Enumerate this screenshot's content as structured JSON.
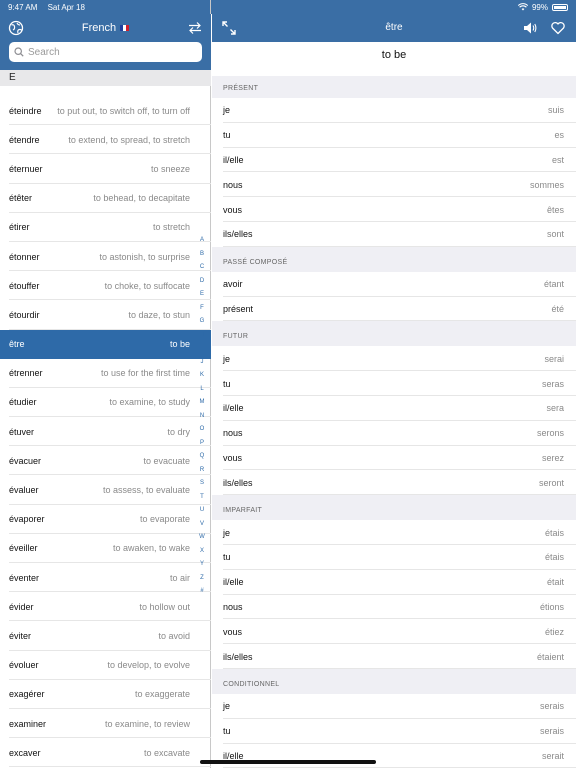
{
  "status_bar": {
    "time": "9:47 AM",
    "date": "Sat Apr 18",
    "battery": "99%"
  },
  "left_header": {
    "language": "French",
    "search_placeholder": "Search"
  },
  "section_letter": "E",
  "words": [
    {
      "fr": "éteindre",
      "en": "to put out, to switch off, to turn off"
    },
    {
      "fr": "étendre",
      "en": "to extend, to spread, to stretch"
    },
    {
      "fr": "éternuer",
      "en": "to sneeze"
    },
    {
      "fr": "étêter",
      "en": "to behead, to decapitate"
    },
    {
      "fr": "étirer",
      "en": "to stretch"
    },
    {
      "fr": "étonner",
      "en": "to astonish, to surprise"
    },
    {
      "fr": "étouffer",
      "en": "to choke, to suffocate"
    },
    {
      "fr": "étourdir",
      "en": "to daze, to stun"
    },
    {
      "fr": "être",
      "en": "to be",
      "selected": true
    },
    {
      "fr": "étrenner",
      "en": "to use for the first time"
    },
    {
      "fr": "étudier",
      "en": "to examine, to study"
    },
    {
      "fr": "étuver",
      "en": "to dry"
    },
    {
      "fr": "évacuer",
      "en": "to evacuate"
    },
    {
      "fr": "évaluer",
      "en": "to assess, to evaluate"
    },
    {
      "fr": "évaporer",
      "en": "to evaporate"
    },
    {
      "fr": "éveiller",
      "en": "to awaken, to wake"
    },
    {
      "fr": "éventer",
      "en": "to air"
    },
    {
      "fr": "évider",
      "en": "to hollow out"
    },
    {
      "fr": "éviter",
      "en": "to avoid"
    },
    {
      "fr": "évoluer",
      "en": "to develop, to evolve"
    },
    {
      "fr": "exagérer",
      "en": "to exaggerate"
    },
    {
      "fr": "examiner",
      "en": "to examine, to review"
    },
    {
      "fr": "excaver",
      "en": "to excavate"
    }
  ],
  "alphabet_index": [
    "A",
    "B",
    "C",
    "D",
    "E",
    "F",
    "G",
    "H",
    "I",
    "J",
    "K",
    "L",
    "M",
    "N",
    "O",
    "P",
    "Q",
    "R",
    "S",
    "T",
    "U",
    "V",
    "W",
    "X",
    "Y",
    "Z",
    "#"
  ],
  "right_header": {
    "verb": "être",
    "translation": "to be"
  },
  "tenses": [
    {
      "name": "PRÉSENT",
      "rows": [
        {
          "pronoun": "je",
          "form": "suis"
        },
        {
          "pronoun": "tu",
          "form": "es"
        },
        {
          "pronoun": "il/elle",
          "form": "est"
        },
        {
          "pronoun": "nous",
          "form": "sommes"
        },
        {
          "pronoun": "vous",
          "form": "êtes"
        },
        {
          "pronoun": "ils/elles",
          "form": "sont"
        }
      ]
    },
    {
      "name": "PASSÉ COMPOSÉ",
      "rows": [
        {
          "pronoun": "avoir",
          "form": "étant"
        },
        {
          "pronoun": "présent",
          "form": "été"
        }
      ]
    },
    {
      "name": "FUTUR",
      "rows": [
        {
          "pronoun": "je",
          "form": "serai"
        },
        {
          "pronoun": "tu",
          "form": "seras"
        },
        {
          "pronoun": "il/elle",
          "form": "sera"
        },
        {
          "pronoun": "nous",
          "form": "serons"
        },
        {
          "pronoun": "vous",
          "form": "serez"
        },
        {
          "pronoun": "ils/elles",
          "form": "seront"
        }
      ]
    },
    {
      "name": "IMPARFAIT",
      "rows": [
        {
          "pronoun": "je",
          "form": "étais"
        },
        {
          "pronoun": "tu",
          "form": "étais"
        },
        {
          "pronoun": "il/elle",
          "form": "était"
        },
        {
          "pronoun": "nous",
          "form": "étions"
        },
        {
          "pronoun": "vous",
          "form": "étiez"
        },
        {
          "pronoun": "ils/elles",
          "form": "étaient"
        }
      ]
    },
    {
      "name": "CONDITIONNEL",
      "rows": [
        {
          "pronoun": "je",
          "form": "serais"
        },
        {
          "pronoun": "tu",
          "form": "serais"
        },
        {
          "pronoun": "il/elle",
          "form": "serait"
        }
      ]
    }
  ],
  "colors": {
    "header_blue": "#3a6ea5",
    "selected_row": "#2e6aa8"
  }
}
